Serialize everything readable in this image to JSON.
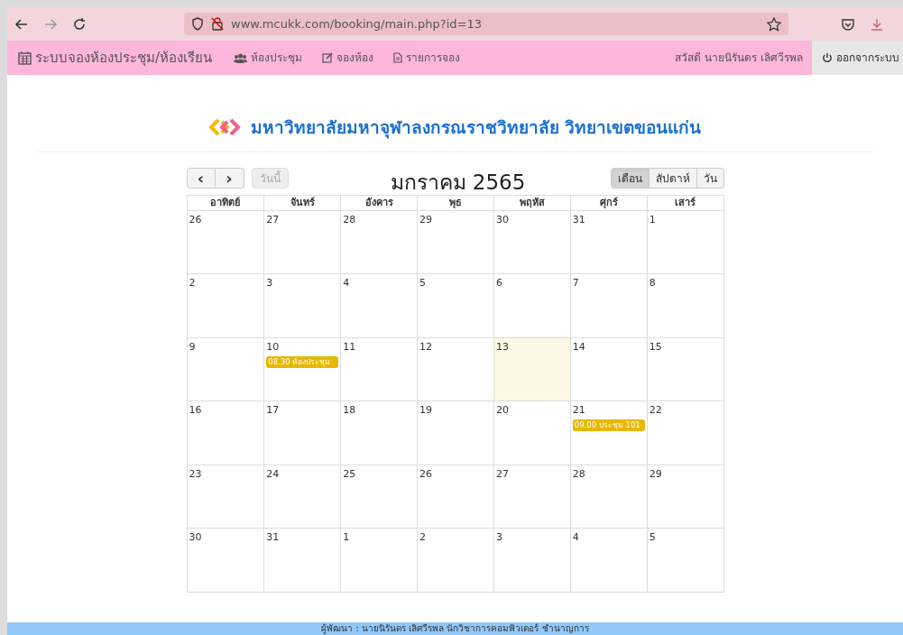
{
  "browser": {
    "url": "www.mcukk.com/booking/main.php?id=13"
  },
  "navbar": {
    "brand": "ระบบจองห้องประชุม/ห้องเรียน",
    "items": [
      {
        "label": "ห้องประชุม",
        "kind": "users"
      },
      {
        "label": "จองห้อง",
        "kind": "edit"
      },
      {
        "label": "รายการจอง",
        "kind": "list"
      }
    ],
    "greeting": "สวัสดี นายนิรันดร เลิศวีรพล",
    "logout": "ออกจากระบบ"
  },
  "header": {
    "title": "มหาวิทยาลัยมหาจุฬาลงกรณราชวิทยาลัย วิทยาเขตขอนแก่น"
  },
  "calendar": {
    "prev": "‹",
    "next": "›",
    "today_button": "วันนี้",
    "title": "มกราคม 2565",
    "views": [
      {
        "label": "เดือน",
        "selected": true
      },
      {
        "label": "สัปดาห์",
        "selected": false
      },
      {
        "label": "วัน",
        "selected": false
      }
    ],
    "weekdays": [
      "อาทิตย์",
      "จันทร์",
      "อังคาร",
      "พุธ",
      "พฤหัส",
      "ศุกร์",
      "เสาร์"
    ],
    "weeks": [
      [
        {
          "day": "26",
          "today": false
        },
        {
          "day": "27",
          "today": false
        },
        {
          "day": "28",
          "today": false
        },
        {
          "day": "29",
          "today": false
        },
        {
          "day": "30",
          "today": false
        },
        {
          "day": "31",
          "today": false
        },
        {
          "day": "1",
          "today": false
        }
      ],
      [
        {
          "day": "2",
          "today": false
        },
        {
          "day": "3",
          "today": false
        },
        {
          "day": "4",
          "today": false
        },
        {
          "day": "5",
          "today": false
        },
        {
          "day": "6",
          "today": false
        },
        {
          "day": "7",
          "today": false
        },
        {
          "day": "8",
          "today": false
        }
      ],
      [
        {
          "day": "9",
          "today": false
        },
        {
          "day": "10",
          "today": false,
          "events": [
            {
              "text": "08.30 ห้องประชุม",
              "color": "#e6b800"
            }
          ]
        },
        {
          "day": "11",
          "today": false
        },
        {
          "day": "12",
          "today": false
        },
        {
          "day": "13",
          "today": true
        },
        {
          "day": "14",
          "today": false
        },
        {
          "day": "15",
          "today": false
        }
      ],
      [
        {
          "day": "16",
          "today": false
        },
        {
          "day": "17",
          "today": false
        },
        {
          "day": "18",
          "today": false
        },
        {
          "day": "19",
          "today": false
        },
        {
          "day": "20",
          "today": false
        },
        {
          "day": "21",
          "today": false,
          "events": [
            {
              "text": "09.00 ประชุม 101",
              "color": "#e6b800"
            }
          ]
        },
        {
          "day": "22",
          "today": false
        }
      ],
      [
        {
          "day": "23",
          "today": false
        },
        {
          "day": "24",
          "today": false
        },
        {
          "day": "25",
          "today": false
        },
        {
          "day": "26",
          "today": false
        },
        {
          "day": "27",
          "today": false
        },
        {
          "day": "28",
          "today": false
        },
        {
          "day": "29",
          "today": false
        }
      ],
      [
        {
          "day": "30",
          "today": false
        },
        {
          "day": "31",
          "today": false
        },
        {
          "day": "1",
          "today": false
        },
        {
          "day": "2",
          "today": false
        },
        {
          "day": "3",
          "today": false
        },
        {
          "day": "4",
          "today": false
        },
        {
          "day": "5",
          "today": false
        }
      ]
    ]
  },
  "footer": {
    "text": "ผู้พัฒนา : นายนิรันดร เลิศวีรพล นักวิชาการคอมพิวเตอร์ ชำนาญการ"
  }
}
